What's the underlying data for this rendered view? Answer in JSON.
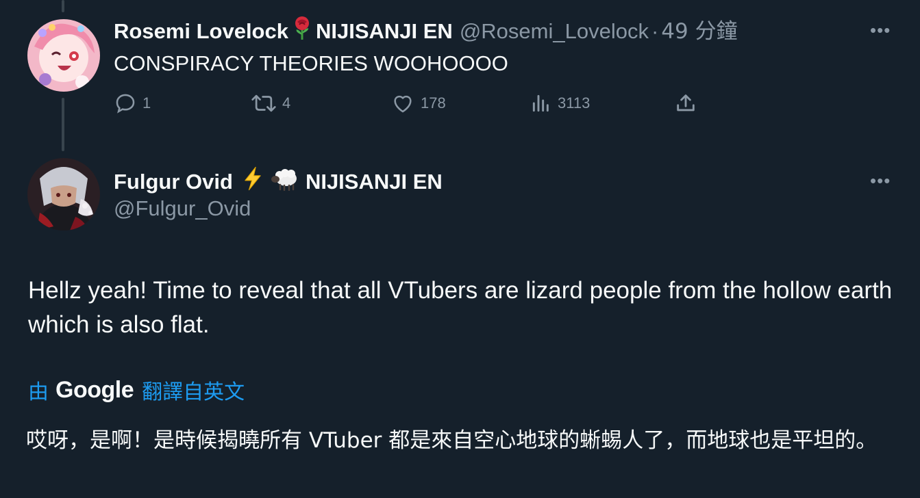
{
  "colors": {
    "background": "#15202b",
    "secondary_text": "#8b98a5",
    "accent": "#1d9bf0",
    "primary_text": "#f7f9f9"
  },
  "parent_tweet": {
    "display_name": "Rosemi Lovelock",
    "emoji": "rose",
    "affiliation": "NIJISANJI EN",
    "handle": "@Rosemi_Lovelock",
    "separator": "·",
    "time": "49 分鐘",
    "text": "CONSPIRACY THEORIES WOOHOOOO",
    "more_label": "•••",
    "actions": {
      "replies": "1",
      "retweets": "4",
      "likes": "178",
      "views": "3113"
    }
  },
  "reply_tweet": {
    "display_name": "Fulgur Ovid",
    "emoji_1": "high-voltage",
    "emoji_2": "sheep",
    "affiliation": "NIJISANJI EN",
    "handle": "@Fulgur_Ovid",
    "more_label": "•••",
    "text": "Hellz yeah! Time to reveal that all VTubers are lizard people from the hollow earth which is also flat.",
    "translation": {
      "by_label": "由",
      "provider": "Google",
      "link_label": "翻譯自英文",
      "text": "哎呀，是啊！是時候揭曉所有 VTuber 都是來自空心地球的蜥蜴人了，而地球也是平坦的。"
    }
  }
}
